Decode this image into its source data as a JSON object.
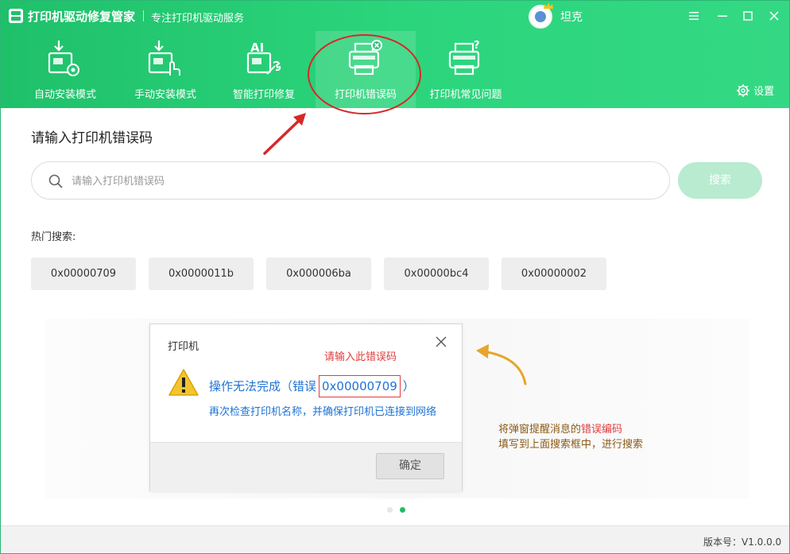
{
  "app": {
    "title": "打印机驱动修复管家",
    "subtitle": "专注打印机驱动服务",
    "username": "坦克"
  },
  "nav": {
    "items": [
      {
        "label": "自动安装模式",
        "icon": "download-settings-icon",
        "active": false
      },
      {
        "label": "手动安装模式",
        "icon": "download-hand-icon",
        "active": false
      },
      {
        "label": "智能打印修复",
        "icon": "ai-wrench-icon",
        "active": false
      },
      {
        "label": "打印机错误码",
        "icon": "printer-error-icon",
        "active": true
      },
      {
        "label": "打印机常见问题",
        "icon": "printer-question-icon",
        "active": false
      }
    ],
    "settings_label": "设置"
  },
  "main": {
    "heading": "请输入打印机错误码",
    "search_placeholder": "请输入打印机错误码",
    "search_button": "搜索",
    "hot_label": "热门搜索:",
    "hot_tags": [
      "0x00000709",
      "0x0000011b",
      "0x000006ba",
      "0x00000bc4",
      "0x00000002"
    ]
  },
  "guide": {
    "dialog_title": "打印机",
    "hint": "请输入此错误码",
    "message_prefix": "操作无法完成（错误",
    "error_code": "0x00000709",
    "message_suffix": "）",
    "message_sub": "再次检查打印机名称，并确保打印机已连接到网络",
    "ok_button": "确定",
    "side_text_part1": "将弹窗提醒消息的",
    "side_text_red": "错误编码",
    "side_text_line2": "填写到上面搜索框中，进行搜索",
    "active_page": 2,
    "total_pages": 2
  },
  "footer": {
    "version": "版本号：V1.0.0.0"
  },
  "colors": {
    "brand_green": "#1fc06a",
    "annotation_red": "#d62828",
    "link_blue": "#1e73d6",
    "arrow_orange": "#e8a52a"
  }
}
